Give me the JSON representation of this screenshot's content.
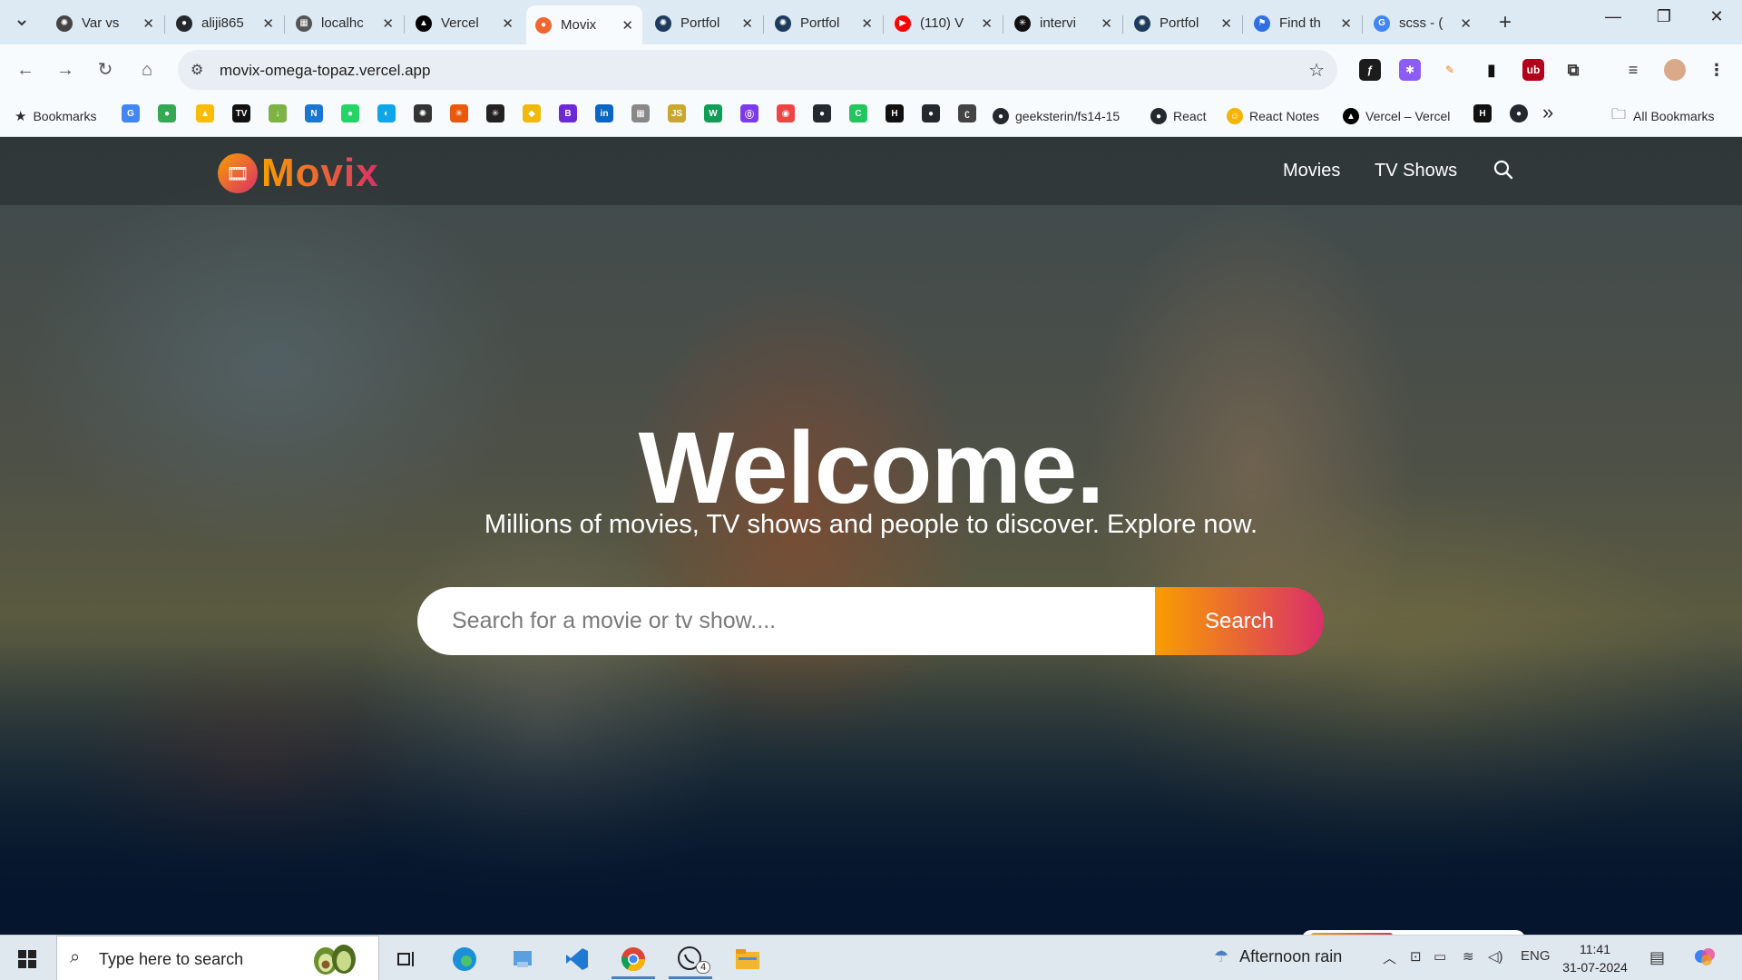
{
  "browser": {
    "tabs": [
      {
        "title": "Var vs",
        "favicon_color": "#444444",
        "favicon": "✺"
      },
      {
        "title": "aliji865",
        "favicon_color": "#24292f",
        "favicon": "●"
      },
      {
        "title": "localhc",
        "favicon_color": "#555555",
        "favicon": "▦"
      },
      {
        "title": "Vercel",
        "favicon_color": "#000000",
        "favicon": "▲"
      },
      {
        "title": "Movix",
        "favicon_color": "#f0662e",
        "favicon": "●",
        "active": true
      },
      {
        "title": "Portfol",
        "favicon_color": "#1e3a5c",
        "favicon": "✺"
      },
      {
        "title": "Portfol",
        "favicon_color": "#1e3a5c",
        "favicon": "✺"
      },
      {
        "title": "(110) V",
        "favicon_color": "#ff0000",
        "favicon": "▶"
      },
      {
        "title": "intervi",
        "favicon_color": "#111111",
        "favicon": "✳"
      },
      {
        "title": "Portfol",
        "favicon_color": "#1e3a5c",
        "favicon": "✺"
      },
      {
        "title": "Find th",
        "favicon_color": "#2f6fe0",
        "favicon": "⚑"
      },
      {
        "title": "scss - (",
        "favicon_color": "#4285f4",
        "favicon": "G"
      }
    ],
    "url": "movix-omega-topaz.vercel.app",
    "bookmarks_label": "Bookmarks",
    "bookmark_items": [
      {
        "label": "geeksterin/fs14-15",
        "icon_color": "#24292f"
      },
      {
        "label": "React",
        "icon_color": "#24292f"
      },
      {
        "label": "React Notes",
        "icon_color": "#f4b400"
      },
      {
        "label": "Vercel – Vercel",
        "icon_color": "#000000"
      }
    ],
    "all_bookmarks_label": "All Bookmarks",
    "more_label": "»"
  },
  "site": {
    "logo_text": "Movix",
    "nav": {
      "movies": "Movies",
      "tv_shows": "TV Shows"
    },
    "hero": {
      "title": "Welcome.",
      "subtitle": "Millions of movies, TV shows and people to discover. Explore now.",
      "search_placeholder": "Search for a movie or tv show....",
      "search_button": "Search"
    },
    "colors": {
      "gradient_start": "#f89e00",
      "gradient_end": "#da2f68",
      "background": "#04152d"
    }
  },
  "taskbar": {
    "search_placeholder": "Type here to search",
    "weather": "Afternoon rain",
    "language": "ENG",
    "time": "11:41",
    "date": "31-07-2024",
    "whatsapp_badge": "4"
  }
}
